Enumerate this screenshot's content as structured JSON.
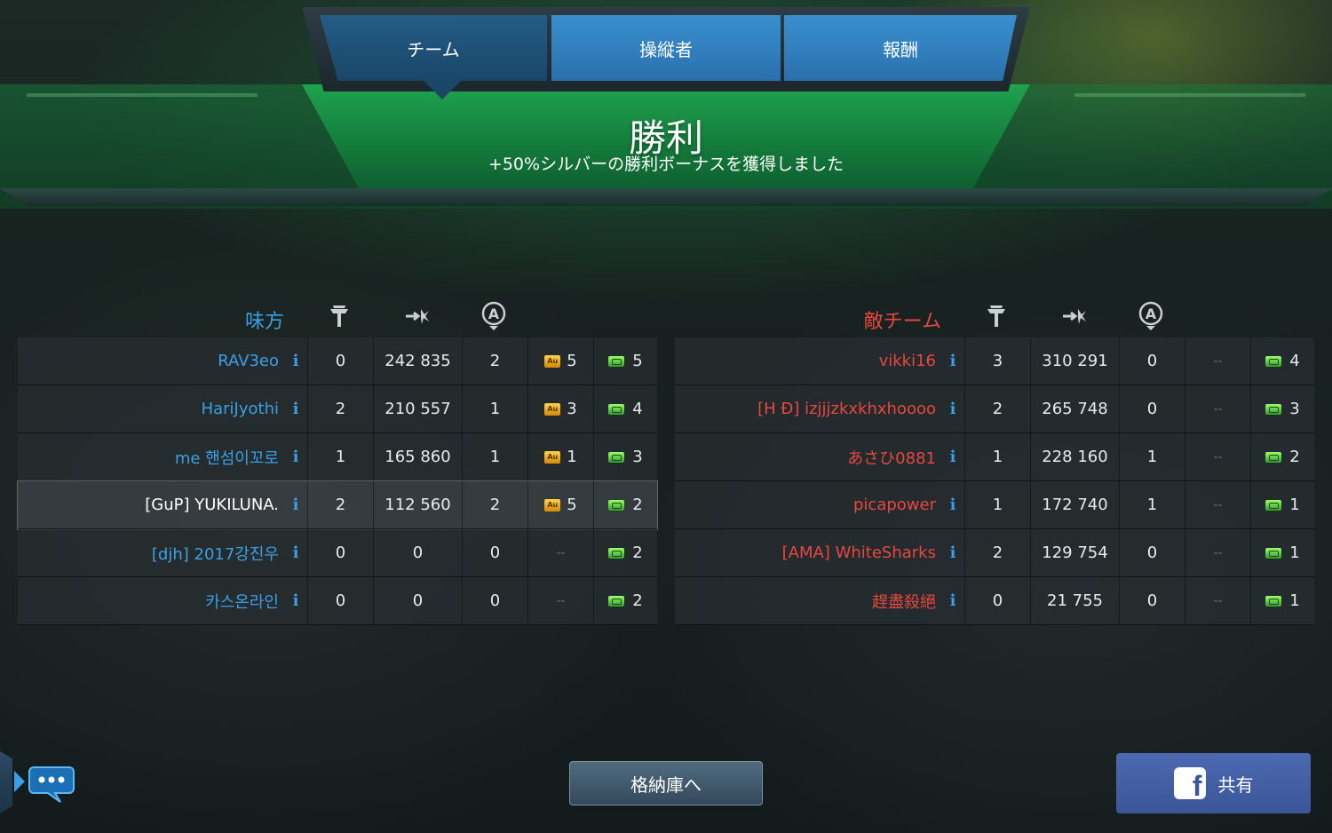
{
  "tabs": [
    {
      "label": "チーム",
      "active": true
    },
    {
      "label": "操縦者",
      "active": false
    },
    {
      "label": "報酬",
      "active": false
    }
  ],
  "result": {
    "title": "勝利",
    "subtitle": "+50%シルバーの勝利ボーナスを獲得しました"
  },
  "column_icons": [
    "robot-kills-icon",
    "damage-icon",
    "beacon-capture-icon",
    "gold-icon",
    "key-icon"
  ],
  "allies": {
    "title": "味方",
    "name_color": "#3aa0e6",
    "players": [
      {
        "name": "RAV3eo",
        "kills": "0",
        "damage": "242 835",
        "beacons": "2",
        "gold": "5",
        "keys": "5"
      },
      {
        "name": "HariJyothi",
        "kills": "2",
        "damage": "210 557",
        "beacons": "1",
        "gold": "3",
        "keys": "4"
      },
      {
        "name": "me 핸섬이꼬로",
        "kills": "1",
        "damage": "165 860",
        "beacons": "1",
        "gold": "1",
        "keys": "3"
      },
      {
        "name": "[GuP] YUKILUNA.",
        "kills": "2",
        "damage": "112 560",
        "beacons": "2",
        "gold": "5",
        "keys": "2",
        "self": true
      },
      {
        "name": "[djh] 2017강진우",
        "kills": "0",
        "damage": "0",
        "beacons": "0",
        "gold": "--",
        "keys": "2"
      },
      {
        "name": "카스온라인",
        "kills": "0",
        "damage": "0",
        "beacons": "0",
        "gold": "--",
        "keys": "2"
      }
    ]
  },
  "enemies": {
    "title": "敵チーム",
    "name_color": "#e8473f",
    "players": [
      {
        "name": "vikki16",
        "kills": "3",
        "damage": "310 291",
        "beacons": "0",
        "gold": "--",
        "keys": "4"
      },
      {
        "name": "[H Ð] izjjjzkxkhxhoooo",
        "kills": "2",
        "damage": "265 748",
        "beacons": "0",
        "gold": "--",
        "keys": "3"
      },
      {
        "name": "あさひ0881",
        "kills": "1",
        "damage": "228 160",
        "beacons": "1",
        "gold": "--",
        "keys": "2"
      },
      {
        "name": "picapower",
        "kills": "1",
        "damage": "172 740",
        "beacons": "1",
        "gold": "--",
        "keys": "1"
      },
      {
        "name": "[AMA] WhiteSharks",
        "kills": "2",
        "damage": "129 754",
        "beacons": "0",
        "gold": "--",
        "keys": "1"
      },
      {
        "name": "趕盡殺絕",
        "kills": "0",
        "damage": "21 755",
        "beacons": "0",
        "gold": "--",
        "keys": "1"
      }
    ]
  },
  "buttons": {
    "hangar": "格納庫へ",
    "share": "共有"
  },
  "colors": {
    "victory_green": "#1fa34e",
    "tab_blue": "#3a8fcf",
    "share_blue": "#3b5597"
  }
}
